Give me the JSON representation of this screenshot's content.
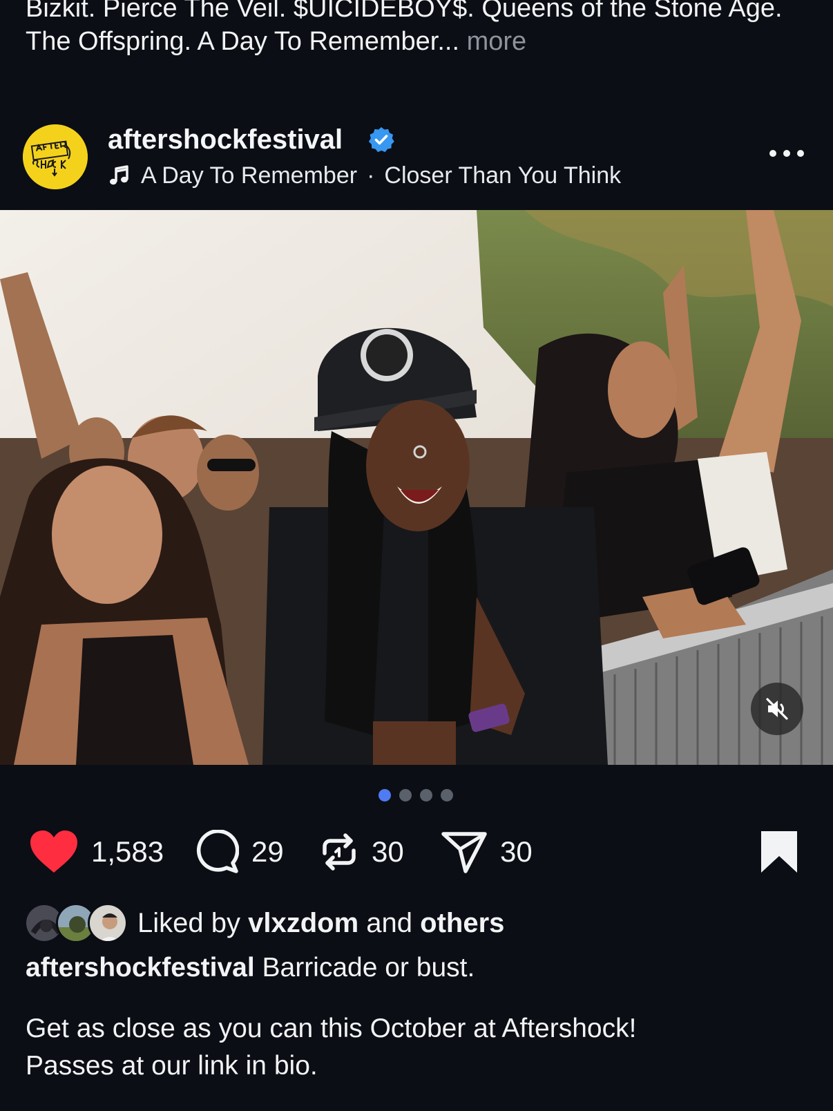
{
  "previous_post": {
    "caption_text": "Bizkit. Pierce The Veil. $UICIDEBOY$. Queens of the Stone Age. The Offspring. A Day To Remember...",
    "more_label": "more"
  },
  "post": {
    "username": "aftershockfestival",
    "avatar_text": "AFTERSHOCK",
    "verified_icon": "verified-badge-icon",
    "music": {
      "icon": "music-note-icon",
      "artist": "A Day To Remember",
      "separator": "·",
      "song": "Closer Than You Think"
    },
    "menu_icon": "more-horizontal-icon",
    "media": {
      "description_icon": "photo",
      "mute_icon": "muted-speaker-icon",
      "carousel": {
        "count": 4,
        "active_index": 0
      }
    },
    "actions": {
      "likes": "1,583",
      "comments": "29",
      "reposts": "30",
      "shares": "30",
      "like_icon": "heart-filled-icon",
      "comment_icon": "comment-bubble-icon",
      "repost_icon": "repost-icon",
      "share_icon": "send-paper-plane-icon",
      "save_icon": "bookmark-filled-icon"
    },
    "liked_by": {
      "prefix": "Liked by",
      "user": "vlxzdom",
      "connector": "and",
      "others": "others"
    },
    "caption": {
      "username": "aftershockfestival",
      "line1": "Barricade or bust.",
      "line2": "Get as close as you can this October at Aftershock!",
      "line3": "Passes at our link in bio."
    }
  },
  "colors": {
    "background": "#0b0e14",
    "text": "#f2f3f5",
    "muted": "#8e939c",
    "like_red": "#ff2d40",
    "verified_blue": "#3897f0",
    "active_dot": "#4f7bf3"
  }
}
